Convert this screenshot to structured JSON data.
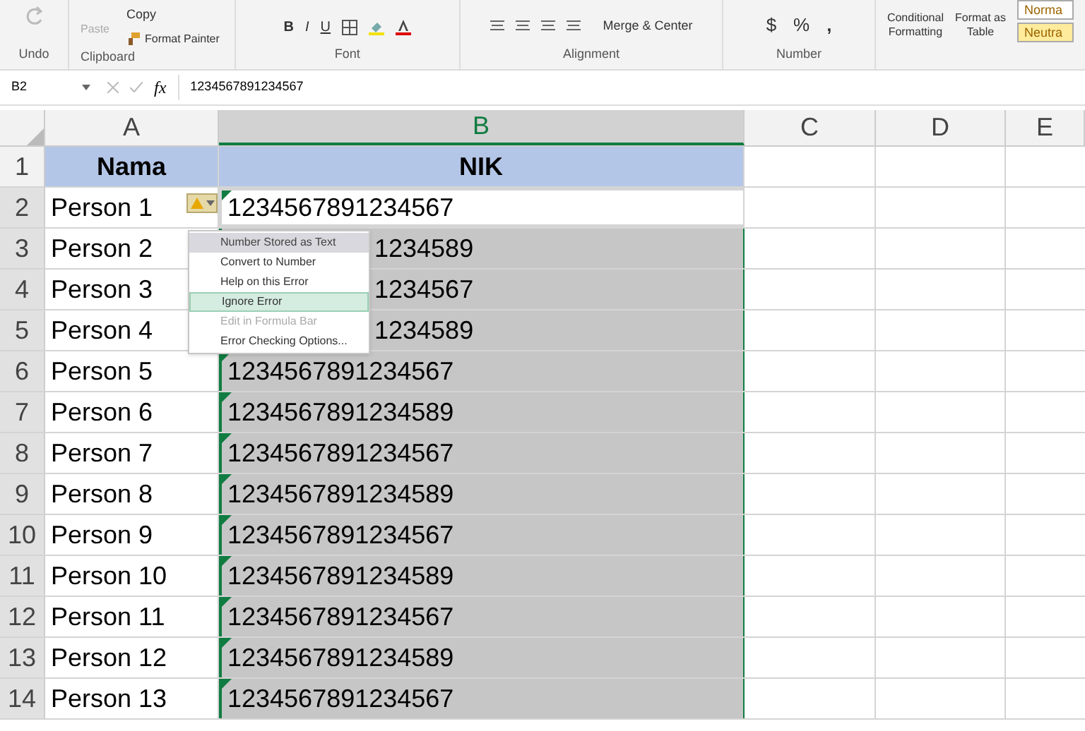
{
  "ribbon": {
    "undo": {
      "label": "Undo"
    },
    "clipboard": {
      "paste": "Paste",
      "copy": "Copy",
      "format_painter": "Format Painter",
      "label": "Clipboard"
    },
    "font": {
      "bold": "B",
      "italic": "I",
      "underline": "U",
      "label": "Font"
    },
    "alignment": {
      "merge": "Merge & Center",
      "label": "Alignment"
    },
    "number": {
      "currency": "$",
      "percent": "%",
      "comma": ",",
      "label": "Number"
    },
    "styles": {
      "conditional": [
        "Conditional",
        "Formatting"
      ],
      "format_table": [
        "Format as",
        "Table"
      ],
      "cells": [
        {
          "label": "Norma",
          "color": "#ffffff"
        },
        {
          "label": "Neutra",
          "color": "#ffeb9c"
        }
      ]
    }
  },
  "formula_bar": {
    "name_box": "B2",
    "fx": "fx",
    "value": "1234567891234567"
  },
  "columns": [
    {
      "label": "A",
      "selected": false
    },
    {
      "label": "B",
      "selected": true
    },
    {
      "label": "C",
      "selected": false
    },
    {
      "label": "D",
      "selected": false
    },
    {
      "label": "E",
      "selected": false
    }
  ],
  "rows": [
    {
      "number": "1",
      "kind": "header",
      "cells": [
        "Nama",
        "NIK"
      ]
    },
    {
      "number": "2",
      "kind": "data",
      "active": true,
      "partial": false,
      "cells": [
        "Person 1",
        "1234567891234567"
      ]
    },
    {
      "number": "3",
      "kind": "data",
      "active": false,
      "partial": true,
      "cells": [
        "Person 2",
        "1234589"
      ]
    },
    {
      "number": "4",
      "kind": "data",
      "active": false,
      "partial": true,
      "cells": [
        "Person 3",
        "1234567"
      ]
    },
    {
      "number": "5",
      "kind": "data",
      "active": false,
      "partial": true,
      "cells": [
        "Person 4",
        "1234589"
      ]
    },
    {
      "number": "6",
      "kind": "data",
      "active": false,
      "partial": false,
      "cells": [
        "Person 5",
        "1234567891234567"
      ]
    },
    {
      "number": "7",
      "kind": "data",
      "active": false,
      "partial": false,
      "cells": [
        "Person 6",
        "1234567891234589"
      ]
    },
    {
      "number": "8",
      "kind": "data",
      "active": false,
      "partial": false,
      "cells": [
        "Person 7",
        "1234567891234567"
      ]
    },
    {
      "number": "9",
      "kind": "data",
      "active": false,
      "partial": false,
      "cells": [
        "Person 8",
        "1234567891234589"
      ]
    },
    {
      "number": "10",
      "kind": "data",
      "active": false,
      "partial": false,
      "cells": [
        "Person 9",
        "1234567891234567"
      ]
    },
    {
      "number": "11",
      "kind": "data",
      "active": false,
      "partial": false,
      "cells": [
        "Person 10",
        "1234567891234589"
      ]
    },
    {
      "number": "12",
      "kind": "data",
      "active": false,
      "partial": false,
      "cells": [
        "Person 11",
        "1234567891234567"
      ]
    },
    {
      "number": "13",
      "kind": "data",
      "active": false,
      "partial": false,
      "cells": [
        "Person 12",
        "1234567891234589"
      ]
    },
    {
      "number": "14",
      "kind": "data",
      "active": false,
      "partial": false,
      "cells": [
        "Person 13",
        "1234567891234567"
      ]
    }
  ],
  "error_menu": {
    "items": [
      {
        "label": "Number Stored as Text",
        "kind": "heading"
      },
      {
        "label": "Convert to Number",
        "kind": "item",
        "selected": false,
        "disabled": false
      },
      {
        "label": "Help on this Error",
        "kind": "item",
        "selected": false,
        "disabled": false
      },
      {
        "label": "Ignore Error",
        "kind": "item",
        "selected": true,
        "disabled": false
      },
      {
        "label": "Edit in Formula Bar",
        "kind": "item",
        "selected": false,
        "disabled": true
      },
      {
        "label": "Error Checking Options...",
        "kind": "item",
        "selected": false,
        "disabled": false
      }
    ]
  }
}
